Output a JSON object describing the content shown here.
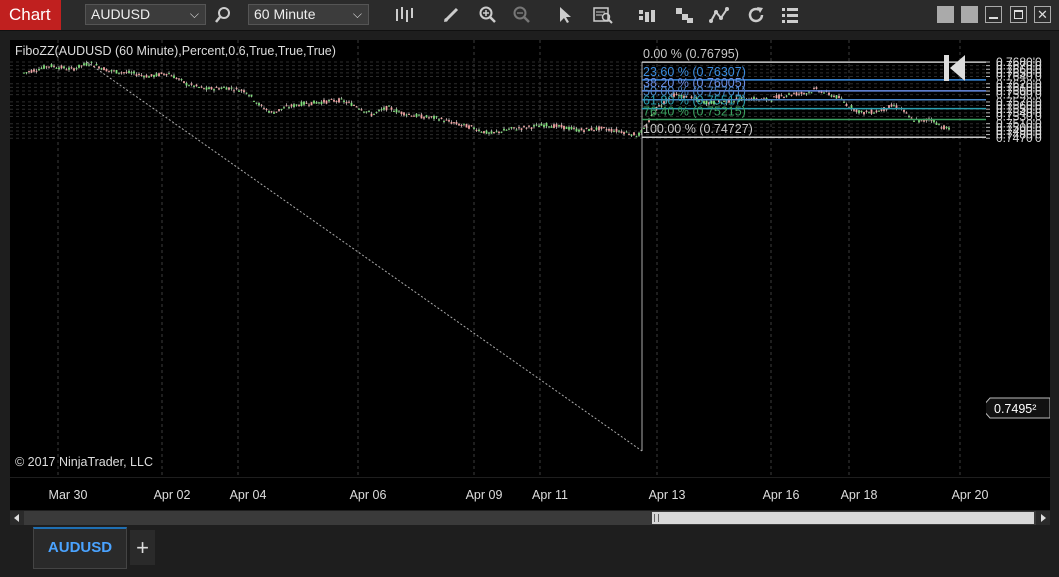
{
  "toolbar": {
    "chart_label": "Chart",
    "instrument": "AUDUSD",
    "interval": "60 Minute"
  },
  "chart": {
    "indicator_label": "FiboZZ(AUDUSD (60 Minute),Percent,0.6,True,True,True)",
    "copyright": "© 2017 NinjaTrader, LLC",
    "current_price": "0.7495²",
    "fib_levels": [
      {
        "label": "0.00 % (0.76795)",
        "color": "#c8c8c8"
      },
      {
        "label": "23.60 % (0.76307)",
        "color": "#3b8de0"
      },
      {
        "label": "38.20 % (0.76005)",
        "color": "#6b8fe8"
      },
      {
        "label": "50.00 % (0.75761)",
        "color": "#4a86c8"
      },
      {
        "label": "61.80 % (0.75517)",
        "color": "#2a9fb0"
      },
      {
        "label": "76.40 % (0.75215)",
        "color": "#3aa060"
      },
      {
        "label": "100.00 % (0.74727)",
        "color": "#c8c8c8"
      }
    ],
    "price_labels": [
      "0.7680'0",
      "0.7670'0",
      "0.7660'0",
      "0.7650'0",
      "0.7640'0",
      "0.7620'0",
      "0.7610'0",
      "0.7600'0",
      "0.7590'0",
      "0.7570'0",
      "0.7560'0",
      "0.7550'0",
      "0.7540'0",
      "0.7530'0",
      "0.7510'0",
      "0.7500'0",
      "0.7490'0",
      "0.7480'0",
      "0.7470'0"
    ],
    "date_labels": [
      "Mar 30",
      "Apr 02",
      "Apr 04",
      "Apr 06",
      "Apr 09",
      "Apr 11",
      "Apr 13",
      "Apr 16",
      "Apr 18",
      "Apr 20"
    ]
  },
  "tabs": {
    "instrument_tab": "AUDUSD",
    "add_tab": "+"
  }
}
